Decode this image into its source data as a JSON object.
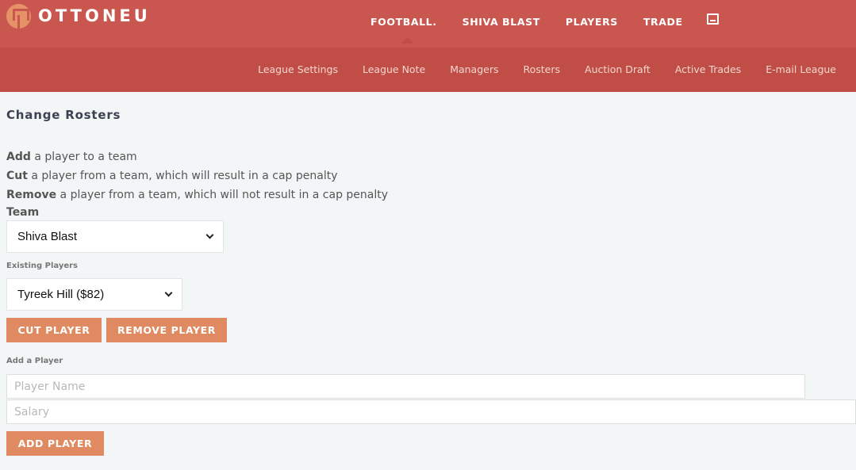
{
  "header": {
    "brand": "OTTONEU",
    "nav": [
      {
        "label": "FOOTBALL."
      },
      {
        "label": "SHIVA BLAST"
      },
      {
        "label": "PLAYERS"
      },
      {
        "label": "TRADE"
      }
    ],
    "icons": {
      "logo": "ottoneu-logo-icon",
      "mail": "mail-icon"
    },
    "colors": {
      "bar": "#c9574f",
      "subbar": "#c14d47",
      "accent": "#e08a62"
    }
  },
  "subnav": [
    {
      "label": "League Settings"
    },
    {
      "label": "League Note"
    },
    {
      "label": "Managers"
    },
    {
      "label": "Rosters"
    },
    {
      "label": "Auction Draft"
    },
    {
      "label": "Active Trades"
    },
    {
      "label": "E-mail League"
    }
  ],
  "page": {
    "title": "Change Rosters",
    "descriptions": [
      {
        "bold": "Add",
        "rest": " a player to a team"
      },
      {
        "bold": "Cut",
        "rest": " a player from a team, which will result in a cap penalty"
      },
      {
        "bold": "Remove",
        "rest": " a player from a team, which will not result in a cap penalty"
      }
    ],
    "team_label": "Team",
    "team_value": "Shiva Blast",
    "existing_label": "Existing Players",
    "existing_value": "Tyreek Hill ($82)",
    "cut_button": "CUT PLAYER",
    "remove_button": "REMOVE PLAYER",
    "add_label": "Add a Player",
    "player_name_placeholder": "Player Name",
    "salary_placeholder": "Salary",
    "add_button": "ADD PLAYER"
  }
}
